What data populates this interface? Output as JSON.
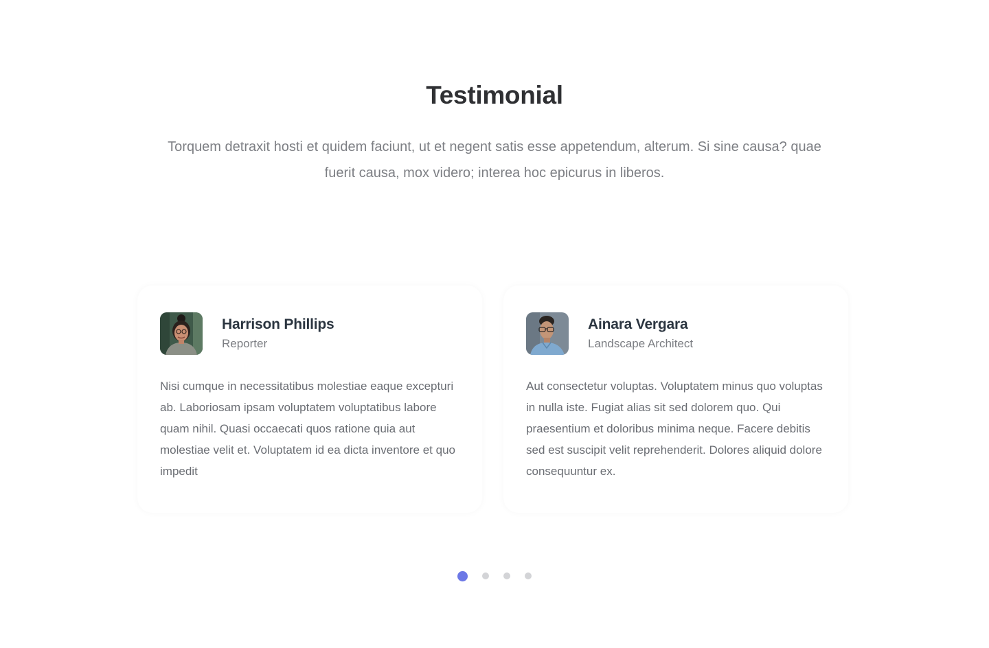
{
  "section": {
    "title": "Testimonial",
    "intro": "Torquem detraxit hosti et quidem faciunt, ut et negent satis esse appetendum, alterum. Si sine causa? quae fuerit causa, mox videro; interea hoc epicurus in liberos."
  },
  "testimonials": [
    {
      "name": "Harrison Phillips",
      "role": "Reporter",
      "quote": "Nisi cumque in necessitatibus molestiae eaque excepturi ab. Laboriosam ipsam voluptatem voluptatibus labore quam nihil. Quasi occaecati quos ratione quia aut molestiae velit et. Voluptatem id ea dicta inventore et quo impedit",
      "avatar": "woman-with-glasses-portrait"
    },
    {
      "name": "Ainara Vergara",
      "role": "Landscape Architect",
      "quote": "Aut consectetur voluptas. Voluptatem minus quo voluptas in nulla iste. Fugiat alias sit sed dolorem quo. Qui praesentium et doloribus minima neque. Facere debitis sed est suscipit velit reprehenderit. Dolores aliquid dolore consequuntur ex.",
      "avatar": "man-with-glasses-portrait"
    }
  ],
  "pagination": {
    "pages": 4,
    "active": 1,
    "active_color": "#6c78e6",
    "inactive_color": "#d3d4d7"
  }
}
